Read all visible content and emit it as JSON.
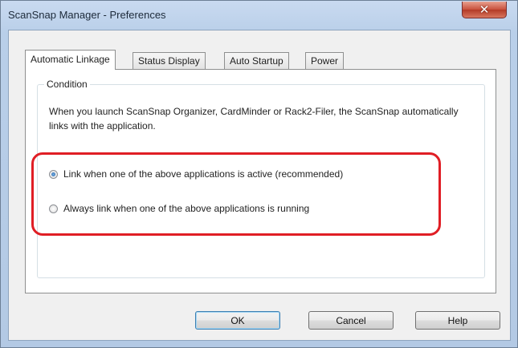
{
  "window": {
    "title": "ScanSnap Manager - Preferences",
    "close_glyph": "✕"
  },
  "tabs": [
    {
      "label": "Automatic Linkage",
      "active": true
    },
    {
      "label": "Status Display",
      "active": false
    },
    {
      "label": "Auto Startup",
      "active": false
    },
    {
      "label": "Power",
      "active": false
    }
  ],
  "condition": {
    "legend": "Condition",
    "description": "When you launch ScanSnap Organizer, CardMinder or Rack2-Filer, the ScanSnap automatically links with the application.",
    "options": [
      {
        "label": "Link when one of the above applications is active (recommended)",
        "checked": true
      },
      {
        "label": "Always link when one of the above applications is running",
        "checked": false
      }
    ]
  },
  "buttons": {
    "ok": "OK",
    "cancel": "Cancel",
    "help": "Help"
  },
  "colors": {
    "highlight": "#e01e25",
    "title_bar": "#b9cfe9"
  },
  "icons": {
    "close": "close-icon"
  }
}
